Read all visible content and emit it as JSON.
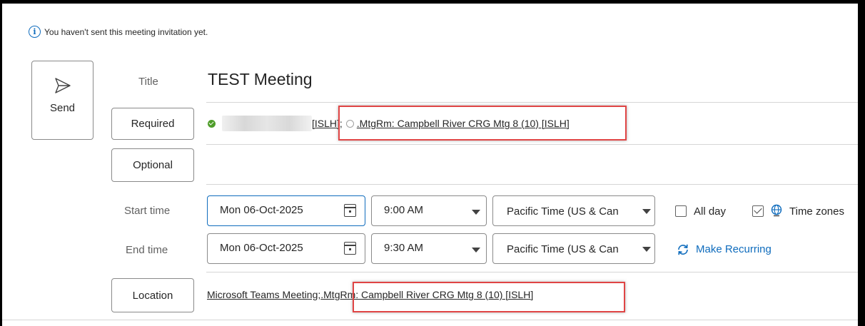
{
  "info_bar": {
    "message": "You haven't sent this meeting invitation yet.",
    "icon": "info-icon"
  },
  "send": {
    "label": "Send",
    "icon": "send-icon"
  },
  "title": {
    "label": "Title",
    "value": "TEST Meeting"
  },
  "required": {
    "button_label": "Required",
    "attendees": [
      {
        "name_suffix": "[ISLH]",
        "status": "accepted",
        "blurred": true
      },
      {
        "name": ".MtgRm: Campbell River CRG Mtg 8 (10) [ISLH]",
        "status": "none",
        "highlighted": true
      }
    ],
    "separator": ";"
  },
  "optional": {
    "button_label": "Optional"
  },
  "start": {
    "label": "Start time",
    "date": "Mon 06-Oct-2025",
    "time": "9:00 AM",
    "timezone": "Pacific Time (US & Can"
  },
  "end": {
    "label": "End time",
    "date": "Mon 06-Oct-2025",
    "time": "9:30 AM",
    "timezone": "Pacific Time (US & Can"
  },
  "options": {
    "all_day_label": "All day",
    "all_day_checked": false,
    "time_zones_label": "Time zones",
    "time_zones_checked": true,
    "make_recurring_label": "Make Recurring"
  },
  "location": {
    "button_label": "Location",
    "teams_text": "Microsoft Teams Meeting",
    "separator": ";",
    "room": ".MtgRm: Campbell River CRG Mtg 8 (10) [ISLH]"
  },
  "colors": {
    "accent": "#0f6cbd",
    "highlight": "#e04545",
    "accepted": "#4f9d2a"
  }
}
